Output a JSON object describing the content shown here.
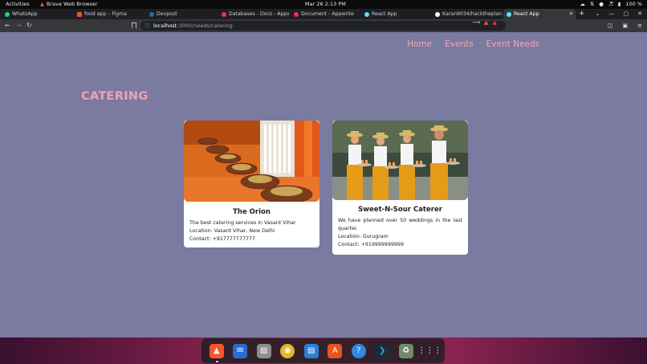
{
  "topbar": {
    "activities": "Activities",
    "app_name": "Brave Web Browser",
    "clock": "Mar 26  2:13 PM",
    "battery": "100 %"
  },
  "tabs": [
    {
      "label": "WhatsApp",
      "color": "#25d366"
    },
    {
      "label": "food app – Figma",
      "color": "#f24e1e"
    },
    {
      "label": "Devpost",
      "color": "#003e54"
    },
    {
      "label": "Databases - Docs - Appwr",
      "color": "#f02e65"
    },
    {
      "label": "Document - Appwrite",
      "color": "#f02e65"
    },
    {
      "label": "React App",
      "color": "#61dafb"
    },
    {
      "label": "Karan9034/hacktheplan",
      "color": "#ffffff"
    },
    {
      "label": "React App",
      "color": "#61dafb",
      "active": true
    }
  ],
  "address": {
    "host": "localhost",
    "path": ":3000/needs/catering"
  },
  "nav": {
    "home": "Home",
    "events": "Events",
    "event_needs": "Event Needs"
  },
  "page_title": "CATERING",
  "cards": [
    {
      "name": "The Orion",
      "description": "The best catering services in Vasant Vihar",
      "location": "Location: Vasant Vihar, New Delhi",
      "contact": "Contact: +917777777777"
    },
    {
      "name": "Sweet-N-Sour Caterer",
      "description": "We have planned over 50 weddings in the last quarter.",
      "location": "Location: Gurugram",
      "contact": "Contact: +919999999999"
    }
  ],
  "dock_apps": [
    "brave-browser",
    "thunderbird",
    "files",
    "rhythmbox",
    "libreoffice-writer",
    "app-center",
    "help",
    "vscode",
    "trash",
    "show-apps"
  ]
}
